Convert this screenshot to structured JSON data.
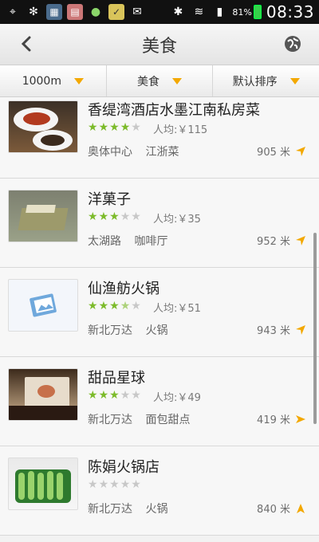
{
  "status_bar": {
    "battery_percent": "81%",
    "time": "08:33"
  },
  "header": {
    "title": "美食"
  },
  "filters": [
    {
      "label": "1000m"
    },
    {
      "label": "美食"
    },
    {
      "label": "默认排序"
    }
  ],
  "colors": {
    "accent": "#f3a800",
    "star_on": "#7cbb2a",
    "star_off": "#c8c8c8"
  },
  "restaurants": [
    {
      "name": "香缇湾酒店水墨江南私房菜",
      "rating": 4,
      "price": "人均:￥115",
      "area": "奥体中心",
      "cuisine": "江浙菜",
      "distance": "905 米",
      "direction": "northeast",
      "thumbnail": "dish-on-plate"
    },
    {
      "name": "洋菓子",
      "rating": 3,
      "price": "人均:￥35",
      "area": "太湖路",
      "cuisine": "咖啡厅",
      "distance": "952 米",
      "direction": "northeast",
      "thumbnail": "cake-slice"
    },
    {
      "name": "仙渔舫火锅",
      "rating": 3.5,
      "price": "人均:￥51",
      "area": "新北万达",
      "cuisine": "火锅",
      "distance": "943 米",
      "direction": "northeast",
      "thumbnail": "placeholder-image"
    },
    {
      "name": "甜品星球",
      "rating": 3,
      "price": "人均:￥49",
      "area": "新北万达",
      "cuisine": "面包甜点",
      "distance": "419 米",
      "direction": "east",
      "thumbnail": "dessert-box"
    },
    {
      "name": "陈娟火锅店",
      "rating": 0,
      "price": "",
      "area": "新北万达",
      "cuisine": "火锅",
      "distance": "840 米",
      "direction": "north",
      "thumbnail": "green-vegetables"
    }
  ]
}
